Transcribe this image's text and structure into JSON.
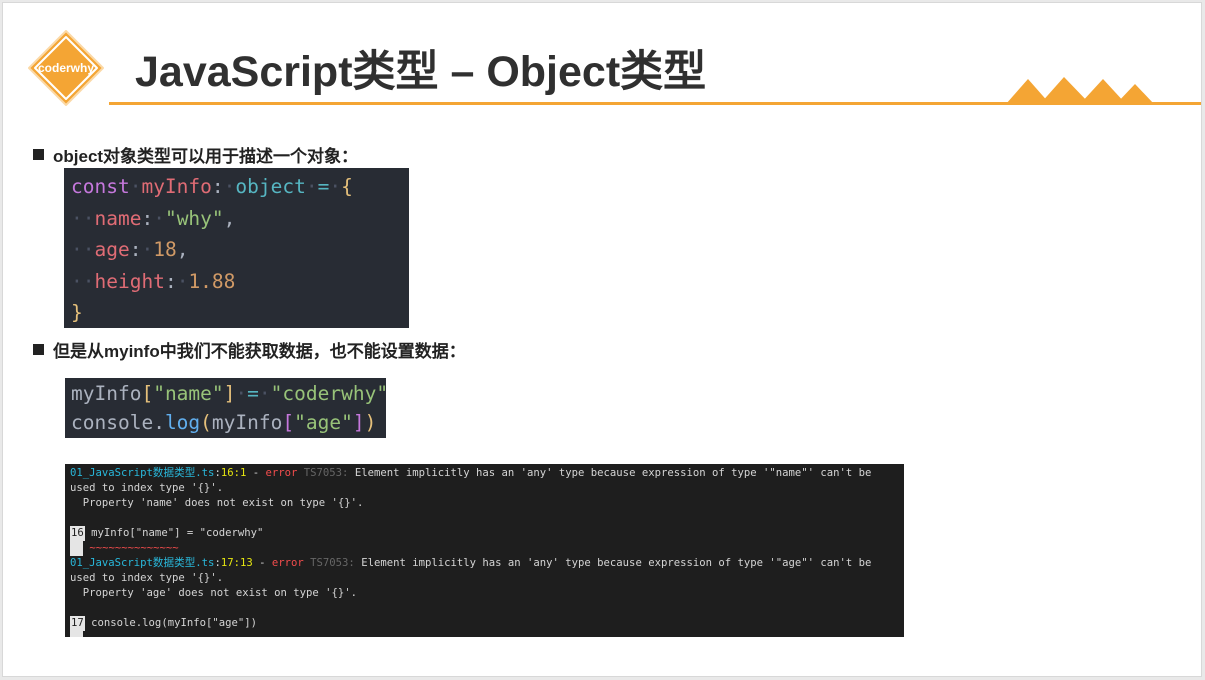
{
  "logo": {
    "text": "coderwhy",
    "color": "#f4a534"
  },
  "title": "JavaScript类型 – Object类型",
  "bullets": [
    "object对象类型可以用于描述一个对象：",
    "但是从myinfo中我们不能获取数据，也不能设置数据："
  ],
  "code_block_1": {
    "line1": {
      "kw": "const",
      "var": "myInfo",
      "colon": ":",
      "type": "object",
      "eq": "=",
      "brace": "{"
    },
    "line2": {
      "key": "name",
      "colon": ":",
      "val": "\"why\"",
      "comma": ","
    },
    "line3": {
      "key": "age",
      "colon": ":",
      "val": "18",
      "comma": ","
    },
    "line4": {
      "key": "height",
      "colon": ":",
      "val": "1.88"
    },
    "line5": {
      "brace": "}"
    }
  },
  "code_block_2": {
    "line1": {
      "obj": "myInfo",
      "lb": "[",
      "key": "\"name\"",
      "rb": "]",
      "eq": "=",
      "val": "\"coderwhy\""
    },
    "line2": {
      "obj": "console",
      "dot": ".",
      "fn": "log",
      "lp": "(",
      "arg": "myInfo",
      "lb": "[",
      "key": "\"age\"",
      "rb": "]",
      "rp": ")"
    }
  },
  "terminal": {
    "error1": {
      "file": "01_JavaScript数据类型.ts",
      "sep1": ":",
      "loc": "16:1",
      "dash": " - ",
      "level": "error",
      "code": "TS7053:",
      "message": "Element implicitly has an 'any' type because expression of type '\"name\"' can't be",
      "message2": "used to index type '{}'.",
      "detail": "  Property 'name' does not exist on type '{}'.",
      "line_no": "16",
      "source": "myInfo[\"name\"] = \"coderwhy\"",
      "squiggle": "~~~~~~~~~~~~~~"
    },
    "error2": {
      "file": "01_JavaScript数据类型.ts",
      "sep1": ":",
      "loc": "17:13",
      "dash": " - ",
      "level": "error",
      "code": "TS7053:",
      "message": "Element implicitly has an 'any' type because expression of type '\"age\"' can't be",
      "message2": "used to index type '{}'.",
      "detail": "  Property 'age' does not exist on type '{}'.",
      "line_no": "17",
      "source": "console.log(myInfo[\"age\"])",
      "squiggle": "~~~~~~~~~~~~~"
    }
  }
}
